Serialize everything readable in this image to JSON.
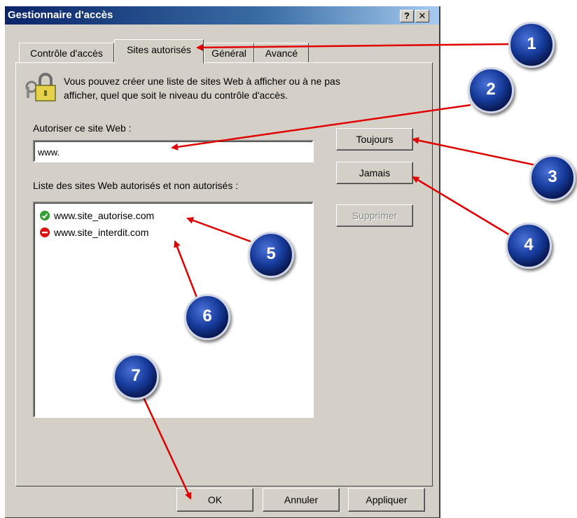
{
  "window": {
    "title": "Gestionnaire d'accès",
    "help_label": "?",
    "close_label": "✕"
  },
  "tabs": [
    {
      "label": "Contrôle d'accès"
    },
    {
      "label": "Sites autorisés"
    },
    {
      "label": "Général"
    },
    {
      "label": "Avancé"
    }
  ],
  "intro": {
    "text_line1": "Vous pouvez créer une liste de sites Web à afficher ou à ne pas",
    "text_line2": "afficher, quel que soit le niveau du contrôle d'accès."
  },
  "allow_site": {
    "label": "Autoriser ce site Web :",
    "value": "www."
  },
  "buttons": {
    "always": "Toujours",
    "never": "Jamais",
    "remove": "Supprimer",
    "ok": "OK",
    "cancel": "Annuler",
    "apply": "Appliquer"
  },
  "list": {
    "label": "Liste des sites Web autorisés et non autorisés :",
    "items": [
      {
        "text": "www.site_autorise.com",
        "status": "allowed",
        "icon": "check-icon",
        "color": "#2e9e2e"
      },
      {
        "text": "www.site_interdit.com",
        "status": "blocked",
        "icon": "no-entry-icon",
        "color": "#e01010"
      }
    ]
  },
  "callouts": [
    "1",
    "2",
    "3",
    "4",
    "5",
    "6",
    "7"
  ],
  "colors": {
    "arrow": "#e00000",
    "titlebar": "#0a246a",
    "face": "#d4d0c8"
  }
}
